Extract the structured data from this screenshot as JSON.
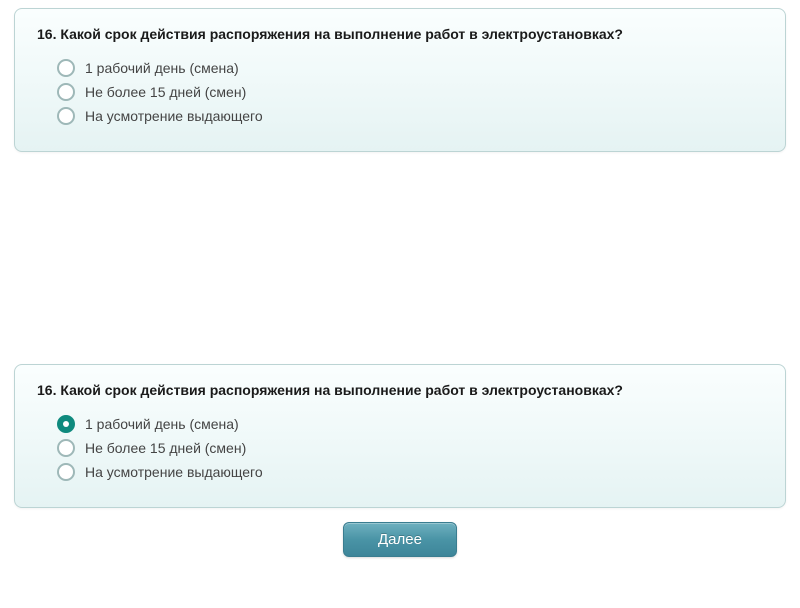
{
  "card1": {
    "question": "16. Какой срок действия распоряжения на выполнение работ в электроустановках?",
    "options": [
      "1 рабочий день (смена)",
      "Не более 15 дней (смен)",
      "На усмотрение выдающего"
    ]
  },
  "card2": {
    "question": "16. Какой срок действия распоряжения на выполнение работ в электроустановках?",
    "options": [
      "1 рабочий день (смена)",
      "Не более 15 дней (смен)",
      "На усмотрение выдающего"
    ],
    "selected_index": 0
  },
  "next_button_label": "Далее"
}
